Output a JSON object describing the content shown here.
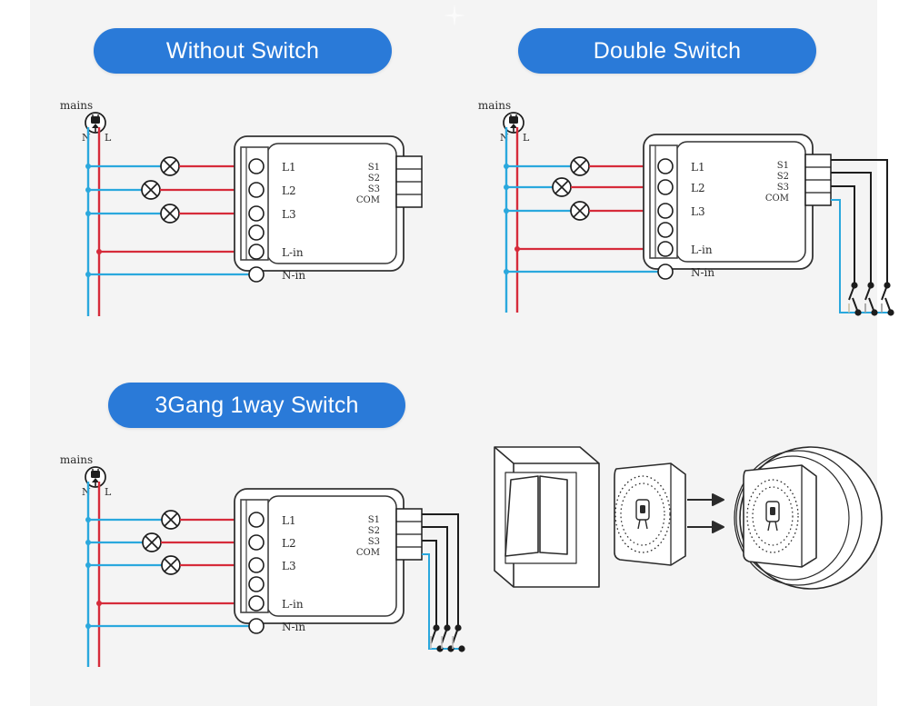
{
  "page": {
    "background": "#f4f4f4",
    "page_background": "#ffffff",
    "accent": "#2a7ad8",
    "live_color": "#d62b3a",
    "neutral_color": "#2aa8dd",
    "line_color": "#2b2b2b"
  },
  "decoration": {
    "sparkle": "sparkle-icon"
  },
  "sections": [
    {
      "id": "without",
      "title": "Without Switch",
      "mains_label": "mains",
      "neutral_label": "N",
      "live_label": "L",
      "module": {
        "left_terminals": [
          "L1",
          "L2",
          "L3",
          "",
          "L-in",
          "N-in"
        ],
        "right_terminals": [
          "S1",
          "S2",
          "S3",
          "COM"
        ]
      },
      "lamps": 3,
      "switches": 0,
      "switch_poles": 0
    },
    {
      "id": "double",
      "title": "Double Switch",
      "mains_label": "mains",
      "neutral_label": "N",
      "live_label": "L",
      "module": {
        "left_terminals": [
          "L1",
          "L2",
          "L3",
          "",
          "L-in",
          "N-in"
        ],
        "right_terminals": [
          "S1",
          "S2",
          "S3",
          "COM"
        ]
      },
      "lamps": 3,
      "switches": 3,
      "switch_poles": 2
    },
    {
      "id": "3gang",
      "title": "3Gang 1way Switch",
      "mains_label": "mains",
      "neutral_label": "N",
      "live_label": "L",
      "module": {
        "left_terminals": [
          "L1",
          "L2",
          "L3",
          "",
          "L-in",
          "N-in"
        ],
        "right_terminals": [
          "S1",
          "S2",
          "S3",
          "COM"
        ]
      },
      "lamps": 3,
      "switches": 3,
      "switch_poles": 1
    }
  ],
  "product_illustration": {
    "name": "wall-switch-installation-illustration",
    "parts": [
      "wall-switch-plate",
      "smart-module",
      "round-wall-box"
    ],
    "arrows": 2
  }
}
